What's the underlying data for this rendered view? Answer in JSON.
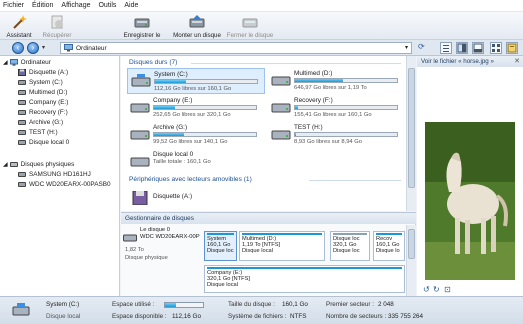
{
  "menu": [
    "Fichier",
    "Édition",
    "Affichage",
    "Outils",
    "Aide"
  ],
  "toolbar": {
    "assistant": "Assistant",
    "recuperer": "Récupérer",
    "enregistrer_disque": "Enregistrer le disque",
    "monter_disque": "Monter un disque",
    "fermer_disque": "Fermer le disque"
  },
  "address": {
    "text": "Ordinateur"
  },
  "tree": {
    "root": "Ordinateur",
    "items": [
      "Disquette (A:)",
      "System (C:)",
      "Multimed (D:)",
      "Company (E:)",
      "Recovery (F:)",
      "Archive (G:)",
      "TEST (H:)",
      "Disque local 0"
    ],
    "physical_root": "Disques physiques",
    "physical": [
      "SAMSUNG HD161HJ",
      "WDC WD20EARX-00PASB0"
    ]
  },
  "center": {
    "section_hard": "Disques durs (7)",
    "drives": [
      {
        "name": "System (C:)",
        "info": "112,16 Go libres sur 160,1 Go",
        "used": 0.3
      },
      {
        "name": "Multimed (D:)",
        "info": "646,97 Go libres sur 1,19 To",
        "used": 0.47
      },
      {
        "name": "Company (E:)",
        "info": "252,65 Go libres sur 320,1 Go",
        "used": 0.21
      },
      {
        "name": "Recovery (F:)",
        "info": "155,41 Go libres sur 160,1 Go",
        "used": 0.03
      },
      {
        "name": "Archive (G:)",
        "info": "99,52 Go libres sur 140,1 Go",
        "used": 0.29
      },
      {
        "name": "TEST (H:)",
        "info": "8,93 Go libres sur 8,94 Go",
        "used": 0.01
      }
    ],
    "local_disk": {
      "name": "Disque local 0",
      "info": "Taille totale : 160,1 Go"
    },
    "section_removable": "Périphériques avec lecteurs amovibles (1)",
    "floppy": "Disquette (A:)"
  },
  "disk_manager": {
    "title": "Gestionnaire de disques",
    "disk0": {
      "line1": "Le disque 0",
      "line2": "WDC WD20EARX-00P",
      "size": "1,82 To",
      "type": "Disque physique"
    },
    "parts": [
      {
        "name": "System",
        "size": "160,1 Go",
        "fs": "Disque loc"
      },
      {
        "name": "Multimed (D:)",
        "size": "1,19 To [NTFS]",
        "fs": "Disque local"
      },
      {
        "name": "Disque loc",
        "size": "320,1 Go",
        "fs": "Disque loc"
      },
      {
        "name": "Recov",
        "size": "160,1 Go",
        "fs": "Disque lo"
      },
      {
        "name": "Company (E:)",
        "size": "320,1 Go [NTFS]",
        "fs": "Disque local"
      }
    ]
  },
  "preview": {
    "title": "Voir le fichier « horse.jpg »"
  },
  "status": {
    "name": "System (C:)",
    "kind": "Disque local",
    "used_label": "Espace utilisé :",
    "used_fraction": 0.3,
    "free_label": "Espace disponible :",
    "free_value": "112,16 Go",
    "size_label": "Taille du disque :",
    "size_value": "160,1 Go",
    "fs_label": "Système de fichiers :",
    "fs_value": "NTFS",
    "first_label": "Premier secteur :",
    "first_value": "2 048",
    "count_label": "Nombre de secteurs :",
    "count_value": "335 755 264"
  },
  "colors": {
    "accent": "#1d96d4",
    "selection": "#dfeefc"
  }
}
